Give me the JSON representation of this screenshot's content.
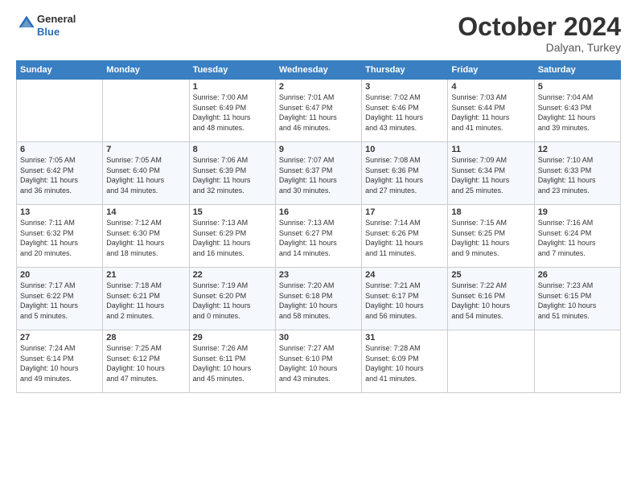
{
  "header": {
    "logo_line1": "General",
    "logo_line2": "Blue",
    "month": "October 2024",
    "location": "Dalyan, Turkey"
  },
  "weekdays": [
    "Sunday",
    "Monday",
    "Tuesday",
    "Wednesday",
    "Thursday",
    "Friday",
    "Saturday"
  ],
  "weeks": [
    [
      {
        "day": "",
        "info": ""
      },
      {
        "day": "",
        "info": ""
      },
      {
        "day": "1",
        "info": "Sunrise: 7:00 AM\nSunset: 6:49 PM\nDaylight: 11 hours\nand 48 minutes."
      },
      {
        "day": "2",
        "info": "Sunrise: 7:01 AM\nSunset: 6:47 PM\nDaylight: 11 hours\nand 46 minutes."
      },
      {
        "day": "3",
        "info": "Sunrise: 7:02 AM\nSunset: 6:46 PM\nDaylight: 11 hours\nand 43 minutes."
      },
      {
        "day": "4",
        "info": "Sunrise: 7:03 AM\nSunset: 6:44 PM\nDaylight: 11 hours\nand 41 minutes."
      },
      {
        "day": "5",
        "info": "Sunrise: 7:04 AM\nSunset: 6:43 PM\nDaylight: 11 hours\nand 39 minutes."
      }
    ],
    [
      {
        "day": "6",
        "info": "Sunrise: 7:05 AM\nSunset: 6:42 PM\nDaylight: 11 hours\nand 36 minutes."
      },
      {
        "day": "7",
        "info": "Sunrise: 7:05 AM\nSunset: 6:40 PM\nDaylight: 11 hours\nand 34 minutes."
      },
      {
        "day": "8",
        "info": "Sunrise: 7:06 AM\nSunset: 6:39 PM\nDaylight: 11 hours\nand 32 minutes."
      },
      {
        "day": "9",
        "info": "Sunrise: 7:07 AM\nSunset: 6:37 PM\nDaylight: 11 hours\nand 30 minutes."
      },
      {
        "day": "10",
        "info": "Sunrise: 7:08 AM\nSunset: 6:36 PM\nDaylight: 11 hours\nand 27 minutes."
      },
      {
        "day": "11",
        "info": "Sunrise: 7:09 AM\nSunset: 6:34 PM\nDaylight: 11 hours\nand 25 minutes."
      },
      {
        "day": "12",
        "info": "Sunrise: 7:10 AM\nSunset: 6:33 PM\nDaylight: 11 hours\nand 23 minutes."
      }
    ],
    [
      {
        "day": "13",
        "info": "Sunrise: 7:11 AM\nSunset: 6:32 PM\nDaylight: 11 hours\nand 20 minutes."
      },
      {
        "day": "14",
        "info": "Sunrise: 7:12 AM\nSunset: 6:30 PM\nDaylight: 11 hours\nand 18 minutes."
      },
      {
        "day": "15",
        "info": "Sunrise: 7:13 AM\nSunset: 6:29 PM\nDaylight: 11 hours\nand 16 minutes."
      },
      {
        "day": "16",
        "info": "Sunrise: 7:13 AM\nSunset: 6:27 PM\nDaylight: 11 hours\nand 14 minutes."
      },
      {
        "day": "17",
        "info": "Sunrise: 7:14 AM\nSunset: 6:26 PM\nDaylight: 11 hours\nand 11 minutes."
      },
      {
        "day": "18",
        "info": "Sunrise: 7:15 AM\nSunset: 6:25 PM\nDaylight: 11 hours\nand 9 minutes."
      },
      {
        "day": "19",
        "info": "Sunrise: 7:16 AM\nSunset: 6:24 PM\nDaylight: 11 hours\nand 7 minutes."
      }
    ],
    [
      {
        "day": "20",
        "info": "Sunrise: 7:17 AM\nSunset: 6:22 PM\nDaylight: 11 hours\nand 5 minutes."
      },
      {
        "day": "21",
        "info": "Sunrise: 7:18 AM\nSunset: 6:21 PM\nDaylight: 11 hours\nand 2 minutes."
      },
      {
        "day": "22",
        "info": "Sunrise: 7:19 AM\nSunset: 6:20 PM\nDaylight: 11 hours\nand 0 minutes."
      },
      {
        "day": "23",
        "info": "Sunrise: 7:20 AM\nSunset: 6:18 PM\nDaylight: 10 hours\nand 58 minutes."
      },
      {
        "day": "24",
        "info": "Sunrise: 7:21 AM\nSunset: 6:17 PM\nDaylight: 10 hours\nand 56 minutes."
      },
      {
        "day": "25",
        "info": "Sunrise: 7:22 AM\nSunset: 6:16 PM\nDaylight: 10 hours\nand 54 minutes."
      },
      {
        "day": "26",
        "info": "Sunrise: 7:23 AM\nSunset: 6:15 PM\nDaylight: 10 hours\nand 51 minutes."
      }
    ],
    [
      {
        "day": "27",
        "info": "Sunrise: 7:24 AM\nSunset: 6:14 PM\nDaylight: 10 hours\nand 49 minutes."
      },
      {
        "day": "28",
        "info": "Sunrise: 7:25 AM\nSunset: 6:12 PM\nDaylight: 10 hours\nand 47 minutes."
      },
      {
        "day": "29",
        "info": "Sunrise: 7:26 AM\nSunset: 6:11 PM\nDaylight: 10 hours\nand 45 minutes."
      },
      {
        "day": "30",
        "info": "Sunrise: 7:27 AM\nSunset: 6:10 PM\nDaylight: 10 hours\nand 43 minutes."
      },
      {
        "day": "31",
        "info": "Sunrise: 7:28 AM\nSunset: 6:09 PM\nDaylight: 10 hours\nand 41 minutes."
      },
      {
        "day": "",
        "info": ""
      },
      {
        "day": "",
        "info": ""
      }
    ]
  ]
}
